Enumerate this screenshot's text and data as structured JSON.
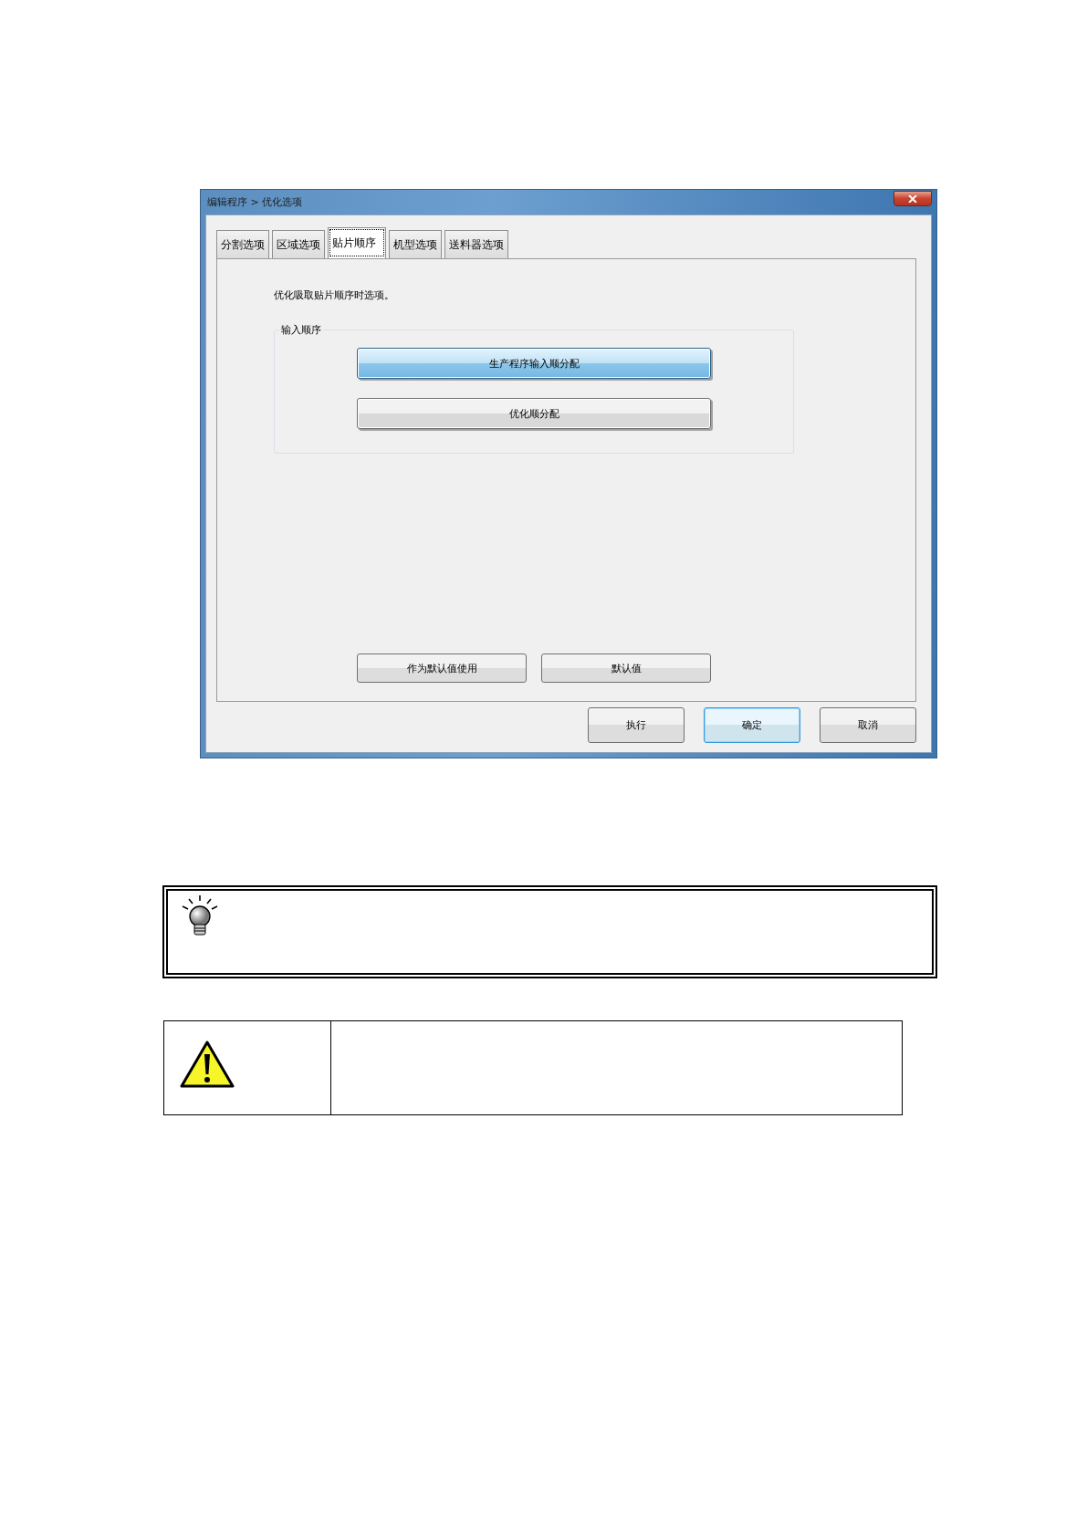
{
  "window": {
    "title": "编辑程序 > 优化选项"
  },
  "tabs": [
    {
      "label": "分割选项",
      "selected": false
    },
    {
      "label": "区域选项",
      "selected": false
    },
    {
      "label": "贴片顺序",
      "selected": true
    },
    {
      "label": "机型选项",
      "selected": false
    },
    {
      "label": "送料器选项",
      "selected": false
    }
  ],
  "description": "优化吸取贴片顺序时选项。",
  "input_order": {
    "label": "输入顺序",
    "options": [
      {
        "label": "生产程序输入顺分配",
        "selected": true
      },
      {
        "label": "优化顺分配",
        "selected": false
      }
    ]
  },
  "panel_buttons": [
    "作为默认值使用",
    "默认值"
  ],
  "dialog_buttons": [
    {
      "label": "执行",
      "default": false
    },
    {
      "label": "确定",
      "default": true
    },
    {
      "label": "取消",
      "default": false
    }
  ]
}
